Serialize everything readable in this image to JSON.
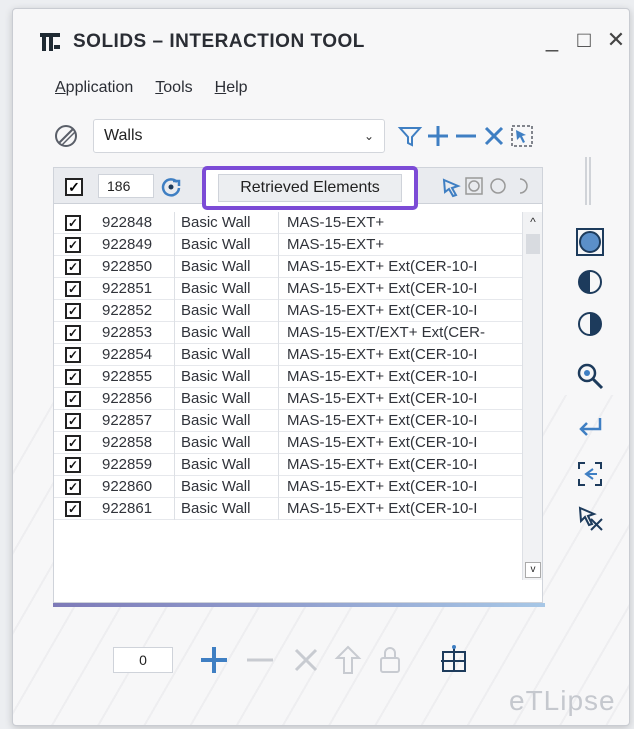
{
  "window": {
    "title": "SOLIDS – INTERACTION TOOL",
    "minimize": "_",
    "maximize": "□",
    "close": "✕"
  },
  "menu": {
    "items": [
      {
        "label_first": "A",
        "label_rest": "pplication"
      },
      {
        "label_first": "T",
        "label_rest": "ools"
      },
      {
        "label_first": "H",
        "label_rest": "elp"
      }
    ]
  },
  "toolbar": {
    "category_value": "Walls",
    "chevron": "⌄"
  },
  "table": {
    "header_check": "✓",
    "count": "186",
    "status": "Retrieved Elements",
    "rows": [
      {
        "check": "✓",
        "id": "922848",
        "category": "Basic Wall",
        "name": "MAS-15-EXT+"
      },
      {
        "check": "✓",
        "id": "922849",
        "category": "Basic Wall",
        "name": "MAS-15-EXT+"
      },
      {
        "check": "✓",
        "id": "922850",
        "category": "Basic Wall",
        "name": "MAS-15-EXT+ Ext(CER-10-I"
      },
      {
        "check": "✓",
        "id": "922851",
        "category": "Basic Wall",
        "name": "MAS-15-EXT+ Ext(CER-10-I"
      },
      {
        "check": "✓",
        "id": "922852",
        "category": "Basic Wall",
        "name": "MAS-15-EXT+ Ext(CER-10-I"
      },
      {
        "check": "✓",
        "id": "922853",
        "category": "Basic Wall",
        "name": "MAS-15-EXT/EXT+ Ext(CER-"
      },
      {
        "check": "✓",
        "id": "922854",
        "category": "Basic Wall",
        "name": "MAS-15-EXT+ Ext(CER-10-I"
      },
      {
        "check": "✓",
        "id": "922855",
        "category": "Basic Wall",
        "name": "MAS-15-EXT+ Ext(CER-10-I"
      },
      {
        "check": "✓",
        "id": "922856",
        "category": "Basic Wall",
        "name": "MAS-15-EXT+ Ext(CER-10-I"
      },
      {
        "check": "✓",
        "id": "922857",
        "category": "Basic Wall",
        "name": "MAS-15-EXT+ Ext(CER-10-I"
      },
      {
        "check": "✓",
        "id": "922858",
        "category": "Basic Wall",
        "name": "MAS-15-EXT+ Ext(CER-10-I"
      },
      {
        "check": "✓",
        "id": "922859",
        "category": "Basic Wall",
        "name": "MAS-15-EXT+ Ext(CER-10-I"
      },
      {
        "check": "✓",
        "id": "922860",
        "category": "Basic Wall",
        "name": "MAS-15-EXT+ Ext(CER-10-I"
      },
      {
        "check": "✓",
        "id": "922861",
        "category": "Basic Wall",
        "name": "MAS-15-EXT+ Ext(CER-10-I"
      }
    ],
    "scroll_up": "^",
    "scroll_down": "v"
  },
  "bottom": {
    "counter": "0"
  },
  "brand": "eTLipse",
  "colors": {
    "accent_purple": "#7c4bd6",
    "icon_blue": "#3f7fc3",
    "icon_dark": "#1d3b5c"
  }
}
